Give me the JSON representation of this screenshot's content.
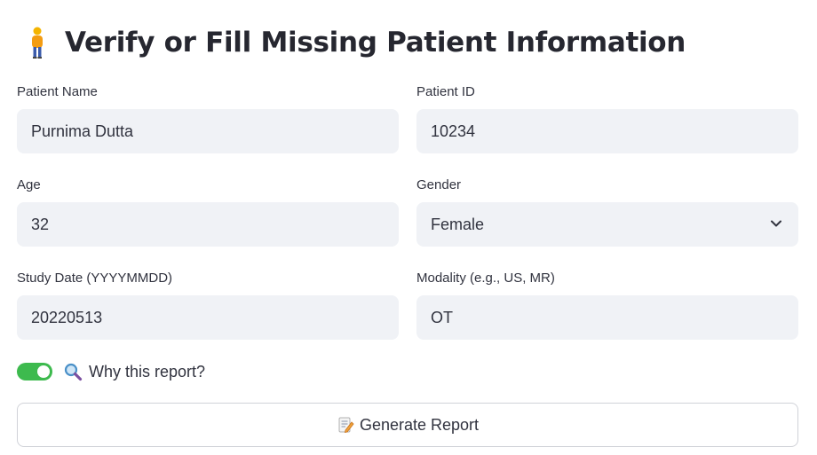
{
  "header": {
    "title": "Verify or Fill Missing Patient Information",
    "icon": "person-standing-icon"
  },
  "form": {
    "patient_name": {
      "label": "Patient Name",
      "value": "Purnima Dutta"
    },
    "patient_id": {
      "label": "Patient ID",
      "value": "10234"
    },
    "age": {
      "label": "Age",
      "value": "32"
    },
    "gender": {
      "label": "Gender",
      "value": "Female"
    },
    "study_date": {
      "label": "Study Date (YYYYMMDD)",
      "value": "20220513"
    },
    "modality": {
      "label": "Modality (e.g., US, MR)",
      "value": "OT"
    }
  },
  "toggle": {
    "label": "Why this report?",
    "on": true,
    "icon": "magnifying-glass-icon",
    "color": "#3dba4e"
  },
  "action": {
    "label": "Generate Report",
    "icon": "memo-icon"
  }
}
